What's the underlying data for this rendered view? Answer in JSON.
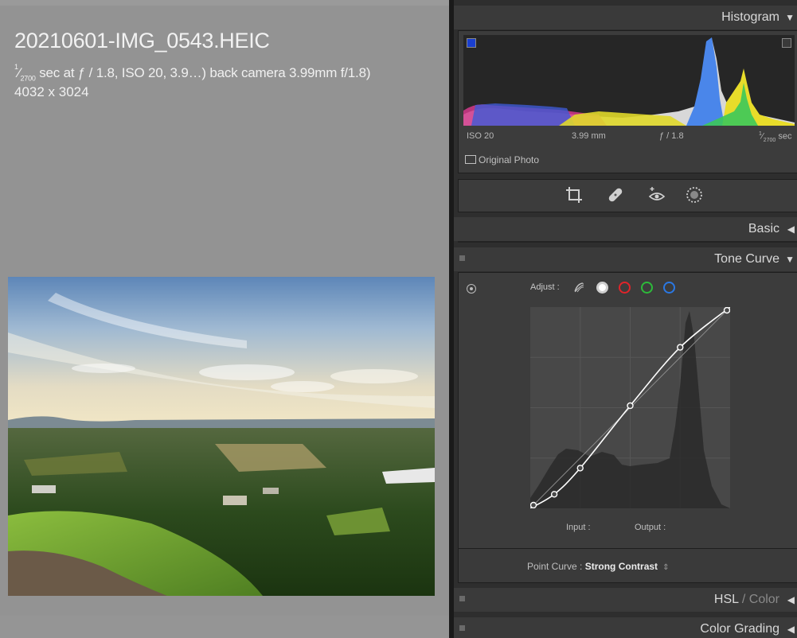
{
  "photo_info": {
    "filename": "20210601-IMG_0543.HEIC",
    "exif_prefix": "1",
    "exif_denominator": "2700",
    "exif_rest": " sec at ƒ / 1.8, ISO 20, 3.9…) back camera 3.99mm f/1.8)",
    "dimensions": "4032 x 3024"
  },
  "histogram": {
    "title": "Histogram",
    "iso": "ISO 20",
    "focal_length": "3.99 mm",
    "aperture": "ƒ / 1.8",
    "shutter_numerator": "1",
    "shutter_denominator": "2700",
    "shutter_unit": "sec",
    "original_photo_label": "Original Photo"
  },
  "tools": [
    "crop-icon",
    "healing-icon",
    "red-eye-icon",
    "masking-icon"
  ],
  "sections": {
    "basic": "Basic",
    "tone_curve": "Tone Curve",
    "hsl": "HSL",
    "hsl_sep": " / ",
    "hsl_color": "Color",
    "color_grading": "Color Grading"
  },
  "tone_curve": {
    "adjust_label": "Adjust :",
    "channels": [
      "parametric",
      "rgb",
      "red",
      "green",
      "blue"
    ],
    "channel_colors": {
      "red": "#e0242a",
      "green": "#2dba3a",
      "blue": "#2a78e4"
    },
    "curve_points": [
      [
        0,
        0
      ],
      [
        0.12,
        0.07
      ],
      [
        0.25,
        0.2
      ],
      [
        0.5,
        0.51
      ],
      [
        0.75,
        0.8
      ],
      [
        1,
        1
      ]
    ],
    "input_label": "Input :",
    "output_label": "Output :",
    "point_curve_label": "Point Curve :",
    "point_curve_value": "Strong Contrast"
  }
}
